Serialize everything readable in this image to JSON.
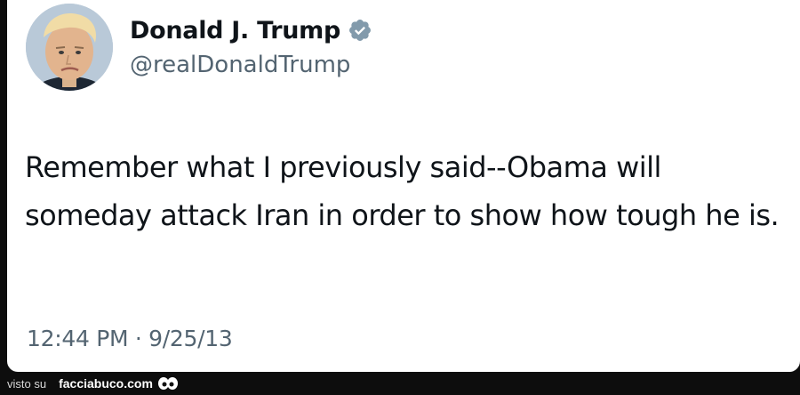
{
  "tweet": {
    "display_name": "Donald J. Trump",
    "handle": "@realDonaldTrump",
    "verified_icon": "verified-badge-icon",
    "text": "Remember what I previously said--Obama will someday attack Iran in order to show how tough he is.",
    "timestamp": "12:44 PM · 9/25/13"
  },
  "footer": {
    "prefix": "visto su",
    "site": "facciabuco.com",
    "icon": "eyes-icon"
  },
  "colors": {
    "background": "#0d0d0d",
    "card": "#ffffff",
    "text_primary": "#0f1419",
    "text_secondary": "#536471",
    "verified": "#829aab"
  }
}
